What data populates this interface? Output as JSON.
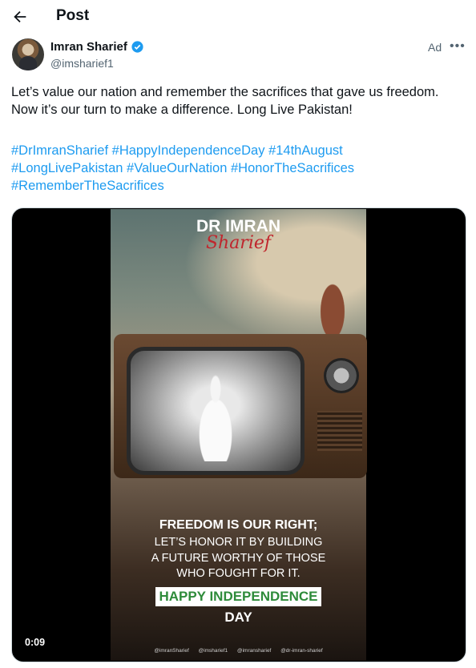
{
  "header": {
    "title": "Post"
  },
  "author": {
    "name": "Imran Sharief",
    "handle": "@imsharief1",
    "ad_label": "Ad"
  },
  "post": {
    "text_line1": "Let’s value our nation and remember the sacrifices that gave us freedom.",
    "text_line2": "Now it’s our turn to make a difference. Long Live Pakistan!",
    "hashtags": [
      [
        "#DrImranSharief",
        "#HappyIndependenceDay",
        "#14thAugust"
      ],
      [
        "#LongLivePakistan",
        "#ValueOurNation",
        "#HonorTheSacrifices"
      ],
      [
        "#RememberTheSacrifices"
      ]
    ]
  },
  "video": {
    "logo_top": "DR IMRAN",
    "logo_script": "Sharief",
    "caption_line1": "FREEDOM IS OUR RIGHT;",
    "caption_line2": "LET’S HONOR IT BY BUILDING",
    "caption_line3": "A FUTURE WORTHY OF THOSE",
    "caption_line4": "WHO FOUGHT FOR IT.",
    "happy_label": "HAPPY INDEPENDENCE",
    "day_label": "DAY",
    "socials": [
      "@imranSharief",
      "@imsharief1",
      "@imransharief",
      "@dr-imran-sharief"
    ],
    "elapsed": "0:09"
  },
  "colors": {
    "link": "#1d9bf0",
    "verified": "#1d9bf0",
    "happy_green": "#2e8b3a"
  }
}
